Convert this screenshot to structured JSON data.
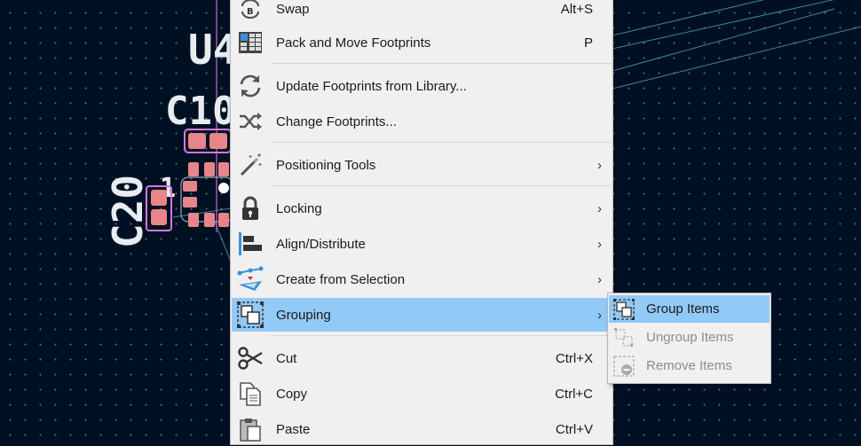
{
  "board": {
    "labels": [
      "U4",
      "C10",
      "C20"
    ]
  },
  "context_menu": {
    "items": [
      {
        "label": "Swap",
        "shortcut": "Alt+S",
        "icon": "swap-icon"
      },
      {
        "label": "Pack and Move Footprints",
        "shortcut": "P",
        "icon": "pack-move-icon"
      },
      {
        "label": "Update Footprints from Library...",
        "shortcut": "",
        "icon": "refresh-icon"
      },
      {
        "label": "Change Footprints...",
        "shortcut": "",
        "icon": "shuffle-icon"
      },
      {
        "label": "Positioning Tools",
        "shortcut": "",
        "icon": "magic-wand-icon",
        "submenu": true
      },
      {
        "label": "Locking",
        "shortcut": "",
        "icon": "lock-icon",
        "submenu": true
      },
      {
        "label": "Align/Distribute",
        "shortcut": "",
        "icon": "align-icon",
        "submenu": true
      },
      {
        "label": "Create from Selection",
        "shortcut": "",
        "icon": "create-from-selection-icon",
        "submenu": true
      },
      {
        "label": "Grouping",
        "shortcut": "",
        "icon": "group-icon",
        "submenu": true,
        "active": true
      },
      {
        "label": "Cut",
        "shortcut": "Ctrl+X",
        "icon": "scissors-icon"
      },
      {
        "label": "Copy",
        "shortcut": "Ctrl+C",
        "icon": "copy-icon"
      },
      {
        "label": "Paste",
        "shortcut": "Ctrl+V",
        "icon": "paste-icon"
      }
    ],
    "submenu_arrow": "›"
  },
  "grouping_submenu": {
    "items": [
      {
        "label": "Group Items",
        "enabled": true,
        "active": true,
        "icon": "group-items-icon"
      },
      {
        "label": "Ungroup Items",
        "enabled": false,
        "icon": "ungroup-items-icon"
      },
      {
        "label": "Remove Items",
        "enabled": false,
        "icon": "remove-items-icon"
      }
    ]
  },
  "colors": {
    "canvas_background": "#001023",
    "highlight": "#91c9f7",
    "menu_background": "#f0f0f0",
    "pad_fill": "#e8858a",
    "selection_outline": "#d27ad8",
    "ratsnest": "#4fa3b8"
  }
}
